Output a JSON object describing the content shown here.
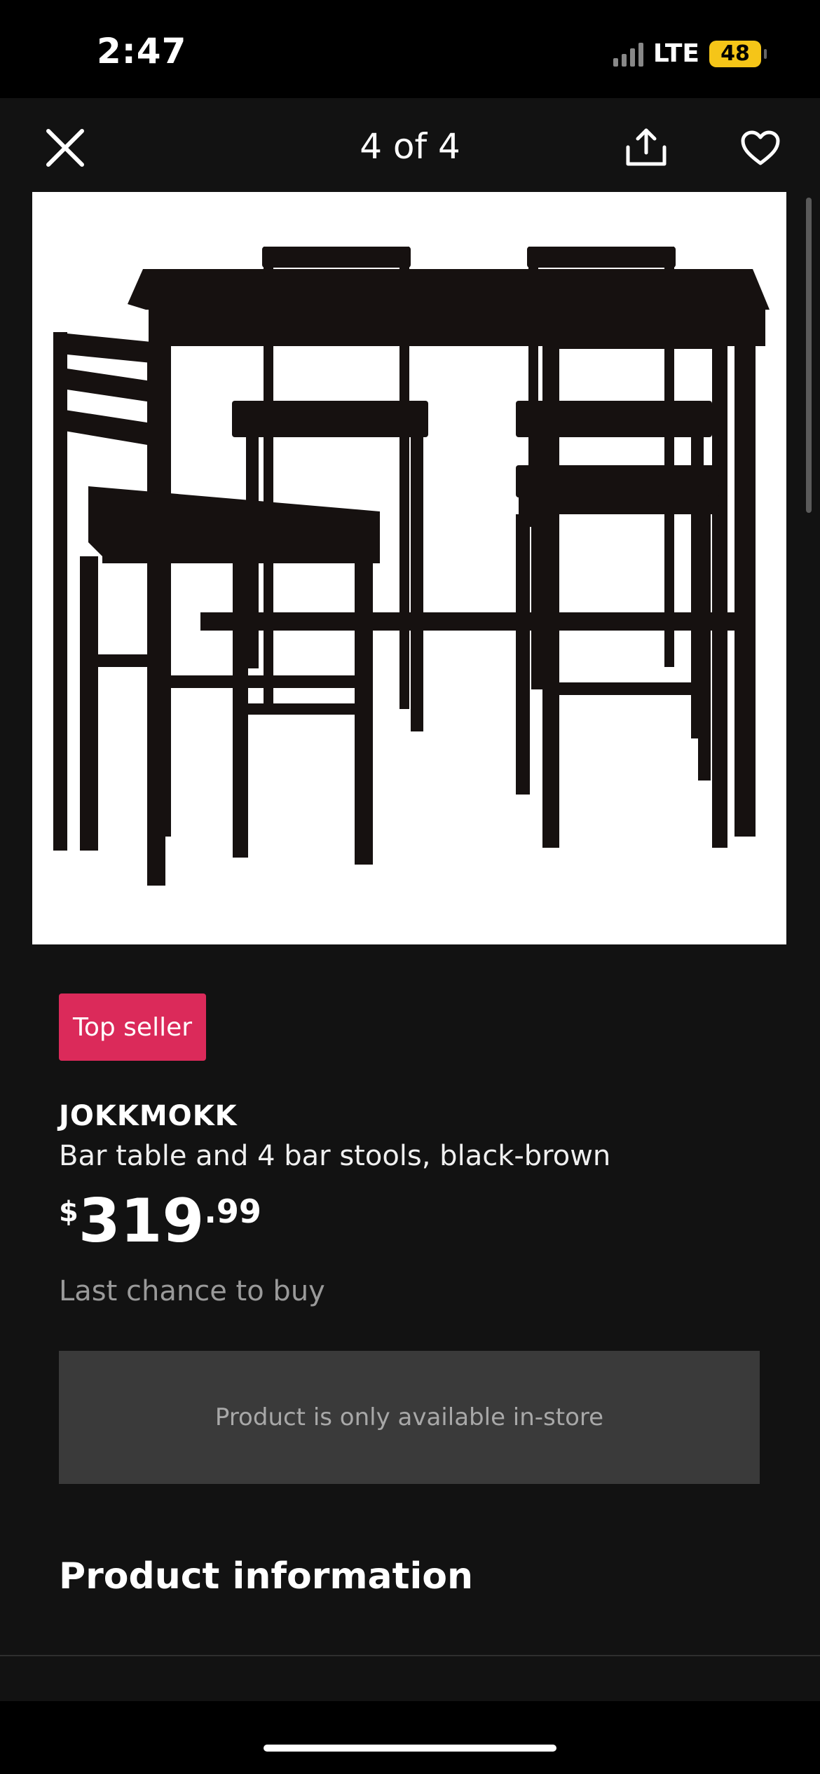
{
  "status_bar": {
    "time": "2:47",
    "network": "LTE",
    "battery": "48"
  },
  "header": {
    "pager": "4 of 4",
    "close_icon": "close-icon",
    "share_icon": "share-icon",
    "favorite_icon": "heart-icon"
  },
  "product": {
    "image_icon": "bar-table-with-four-stools",
    "badge": "Top seller",
    "name": "JOKKMOKK",
    "description": "Bar table and 4 bar stools, black-brown",
    "price": {
      "currency": "$",
      "integer": "319",
      "decimal": ".99"
    },
    "availability": "Last chance to buy",
    "store_notice": "Product is only available in-store"
  },
  "sections": {
    "product_information": "Product information"
  },
  "colors": {
    "background": "#121212",
    "badge": "#db2a5a",
    "notice_box": "#3a3a3a",
    "battery": "#f5c518"
  }
}
